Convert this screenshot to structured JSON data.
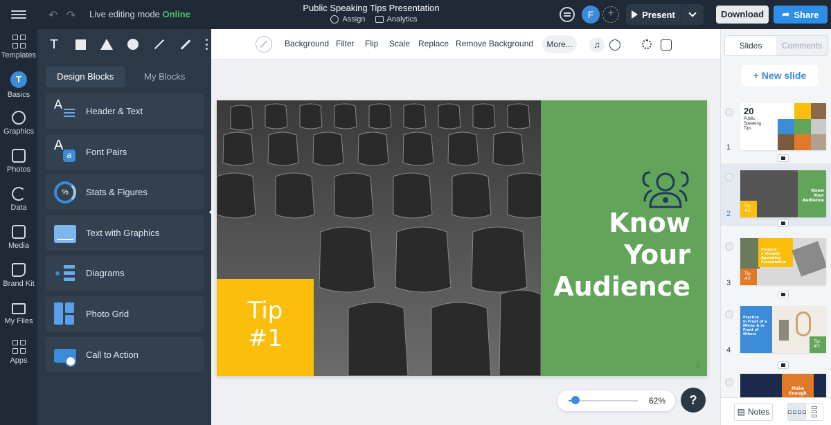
{
  "topbar": {
    "mode_label": "Live editing mode",
    "mode_status": "Online",
    "doc_title": "Public Speaking Tips Presentation",
    "assign_label": "Assign",
    "analytics_label": "Analytics",
    "avatar_initial": "F",
    "present_label": "Present",
    "download_label": "Download",
    "share_label": "Share"
  },
  "rail": [
    {
      "label": "Templates",
      "icon": "templates-icon"
    },
    {
      "label": "Basics",
      "icon": "basics-icon"
    },
    {
      "label": "Graphics",
      "icon": "graphics-icon"
    },
    {
      "label": "Photos",
      "icon": "photos-icon"
    },
    {
      "label": "Data",
      "icon": "data-icon"
    },
    {
      "label": "Media",
      "icon": "media-icon"
    },
    {
      "label": "Brand Kit",
      "icon": "brand-kit-icon"
    },
    {
      "label": "My Files",
      "icon": "folder-icon"
    },
    {
      "label": "Apps",
      "icon": "apps-icon"
    }
  ],
  "rail_active_letter": "T",
  "panel": {
    "tools_text_icon": "T",
    "tabs": [
      "Design Blocks",
      "My Blocks"
    ],
    "blocks": [
      {
        "label": "Header & Text",
        "icon": "header-text-icon"
      },
      {
        "label": "Font Pairs",
        "icon": "font-pairs-icon"
      },
      {
        "label": "Stats & Figures",
        "icon": "stats-icon"
      },
      {
        "label": "Text with Graphics",
        "icon": "text-graphics-icon"
      },
      {
        "label": "Diagrams",
        "icon": "diagrams-icon"
      },
      {
        "label": "Photo Grid",
        "icon": "photo-grid-icon"
      },
      {
        "label": "Call to Action",
        "icon": "cta-icon"
      }
    ]
  },
  "image_toolbar": {
    "options": [
      "Background",
      "Filter",
      "Flip",
      "Scale",
      "Replace",
      "Remove Background"
    ],
    "more_label": "More..."
  },
  "slide": {
    "heading": "Know\nYour\nAudience",
    "tip": "Tip\n#1",
    "page_number": "2"
  },
  "zoom": {
    "value": "62%",
    "fraction": 0.1
  },
  "help_label": "?",
  "slides_panel": {
    "tabs": [
      "Slides",
      "Comments"
    ],
    "new_slide_label": "+ New slide",
    "thumbs": [
      {
        "num": "1",
        "big": "20",
        "text": "Public\nSpeaking\nTips"
      },
      {
        "num": "2",
        "text": "Know\nYour\nAudience",
        "tip": "Tip\n#1"
      },
      {
        "num": "3",
        "text": "Prepare\na Visually\nAppealing\nPresentation",
        "tip": "Tip\n#2"
      },
      {
        "num": "4",
        "text": "Practice\nin Front of a\nMirror & in\nFront of\nOthers",
        "tip": "Tip\n#3"
      },
      {
        "text": "Make\nEnough"
      }
    ],
    "notes_label": "Notes"
  },
  "colors": {
    "accent": "#2d8ee8",
    "slide_green": "#62a55a",
    "tip_yellow": "#fbbf0b",
    "online": "#4cc36a",
    "orange": "#e07a2a"
  }
}
